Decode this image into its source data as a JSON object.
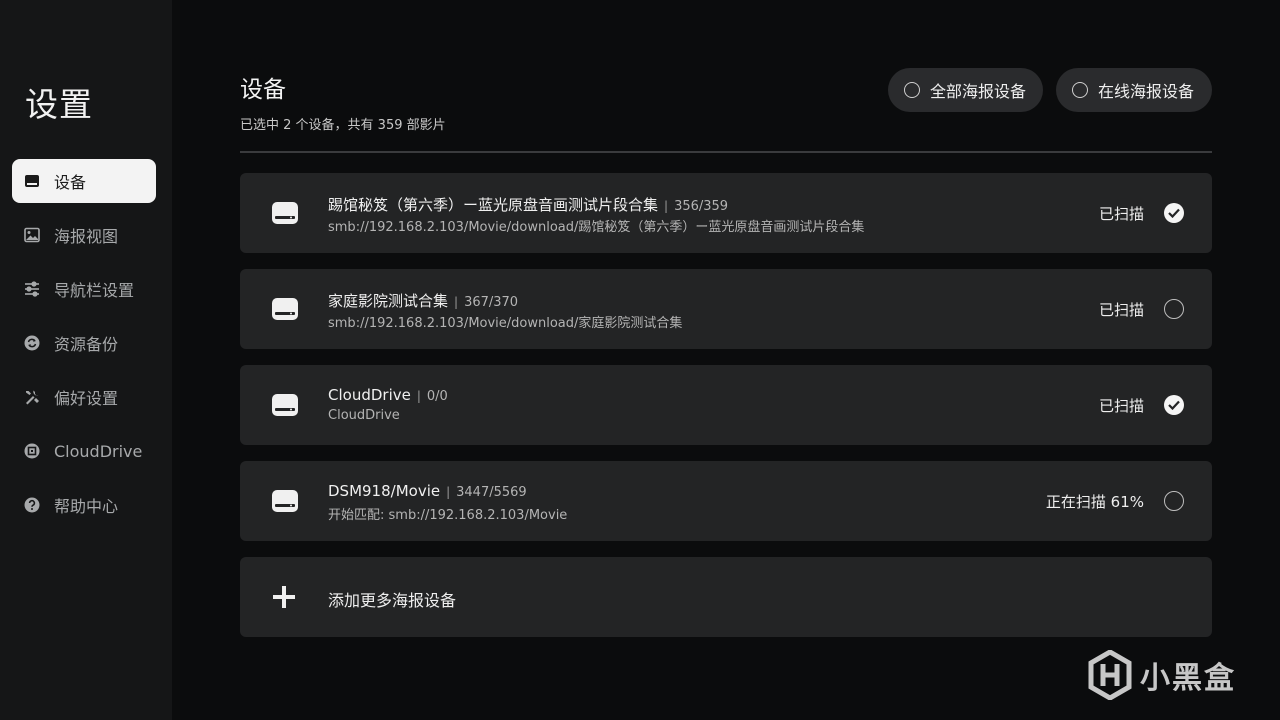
{
  "sidebar": {
    "title": "设置",
    "items": [
      {
        "label": "设备",
        "icon": "drive-icon",
        "active": true
      },
      {
        "label": "海报视图",
        "icon": "image-icon"
      },
      {
        "label": "导航栏设置",
        "icon": "sliders-icon"
      },
      {
        "label": "资源备份",
        "icon": "sync-icon"
      },
      {
        "label": "偏好设置",
        "icon": "tools-icon"
      },
      {
        "label": "CloudDrive",
        "icon": "clouddrive-icon"
      },
      {
        "label": "帮助中心",
        "icon": "help-icon"
      }
    ]
  },
  "header": {
    "title": "设备",
    "subtitle": "已选中 2 个设备，共有 359 部影片",
    "filter_all": "全部海报设备",
    "filter_online": "在线海报设备"
  },
  "devices": [
    {
      "name": "踢馆秘笈（第六季）ー蓝光原盘音画测试片段合集",
      "count": "356/359",
      "path": "smb://192.168.2.103/Movie/download/踢馆秘笈（第六季）ー蓝光原盘音画测试片段合集",
      "status": "已扫描",
      "checked": true
    },
    {
      "name": "家庭影院测试合集",
      "count": "367/370",
      "path": "smb://192.168.2.103/Movie/download/家庭影院测试合集",
      "status": "已扫描",
      "checked": false
    },
    {
      "name": "CloudDrive",
      "count": "0/0",
      "path": "CloudDrive",
      "status": "已扫描",
      "checked": true
    },
    {
      "name": "DSM918/Movie",
      "count": "3447/5569",
      "path": "开始匹配: smb://192.168.2.103/Movie",
      "status": "正在扫描 61%",
      "checked": false
    }
  ],
  "add_device": "添加更多海报设备",
  "watermark": {
    "text": "小黑盒",
    "icon": "xiaoheihe-logo"
  },
  "colors": {
    "background": "#0b0c0d",
    "sidebar": "#151617",
    "card": "#232425",
    "active": "#f3f3f3"
  }
}
